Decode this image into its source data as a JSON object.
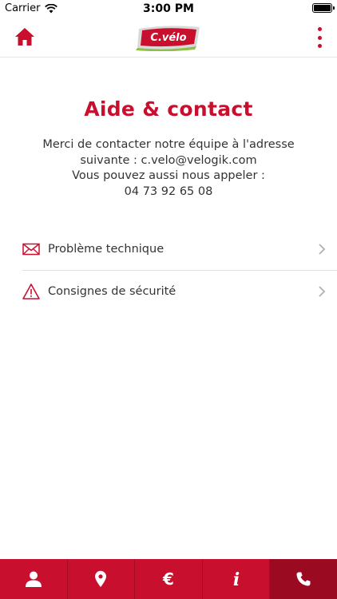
{
  "status_bar": {
    "carrier": "Carrier",
    "time": "3:00 PM",
    "battery_level": 1.0
  },
  "nav": {
    "logo_text": "C.vélo",
    "home_icon": "home-icon",
    "menu_icon": "more-vertical-icon"
  },
  "page": {
    "title": "Aide & contact",
    "info_lines": [
      "Merci de contacter notre équipe à l'adresse",
      "suivante : c.velo@velogik.com",
      "Vous pouvez aussi nous appeler :",
      "04 73 92 65 08"
    ]
  },
  "menu": {
    "items": [
      {
        "label": "Problème technique",
        "icon": "envelope-icon"
      },
      {
        "label": "Consignes de sécurité",
        "icon": "warning-icon"
      }
    ]
  },
  "tab_bar": {
    "tabs": [
      {
        "icon": "user-icon",
        "active": false
      },
      {
        "icon": "map-pin-icon",
        "active": false
      },
      {
        "icon": "euro-icon",
        "label": "€",
        "active": false
      },
      {
        "icon": "info-icon",
        "label": "i",
        "active": false
      },
      {
        "icon": "phone-icon",
        "active": true
      }
    ]
  },
  "colors": {
    "accent": "#c8102e",
    "accent_dark": "#9a0a20",
    "text": "#333333",
    "divider": "#e0e0e0"
  }
}
